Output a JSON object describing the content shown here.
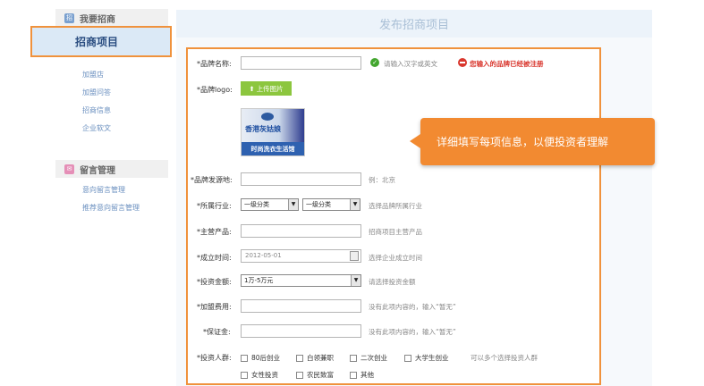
{
  "sidebar": {
    "section1_title": "我要招商",
    "active_item": "招商项目",
    "links": [
      "加盟店",
      "加盟问答",
      "招商信息",
      "企业软文"
    ],
    "section2_title": "留言管理",
    "links2": [
      "意向留言管理",
      "推荐意向留言管理"
    ]
  },
  "main": {
    "title": "发布招商项目"
  },
  "form": {
    "brand_name": {
      "label": "*品牌名称:",
      "hint": "请输入汉字或英文",
      "error": "您输入的品牌已经被注册"
    },
    "brand_logo": {
      "label": "*品牌logo:",
      "upload_label": "上传图片",
      "logo_text": "香港灰姑娘",
      "logo_bar": "时尚洗衣生活馆"
    },
    "origin": {
      "label": "*品牌发源地:",
      "hint": "例：北京"
    },
    "industry": {
      "label": "*所属行业:",
      "level1": "一级分类",
      "level2": "一级分类",
      "hint": "选择品牌所属行业"
    },
    "product": {
      "label": "*主营产品:",
      "hint": "招商项目主营产品"
    },
    "founded": {
      "label": "*成立时间:",
      "value": "2012-05-01",
      "hint": "选择企业成立时间"
    },
    "investment": {
      "label": "*投资金额:",
      "value": "1万-5万元",
      "hint": "请选择投资金额"
    },
    "join_fee": {
      "label": "*加盟费用:",
      "hint": "没有此项内容的，输入“暂无”"
    },
    "deposit": {
      "label": "*保证金:",
      "hint": "没有此项内容的，输入“暂无”"
    },
    "investors": {
      "label": "*投资人群:",
      "options_row1": [
        "80后创业",
        "白领兼职",
        "二次创业",
        "大学生创业"
      ],
      "hint": "可以多个选择投资人群",
      "options_row2": [
        "女性投资",
        "农民致富",
        "其他"
      ]
    }
  },
  "callout": {
    "text": "详细填写每项信息，以便投资者理解"
  },
  "colors": {
    "accent_orange": "#f0923c",
    "error_red": "#d9372e",
    "ok_green": "#43a62f",
    "upload_green": "#8cc63e"
  }
}
